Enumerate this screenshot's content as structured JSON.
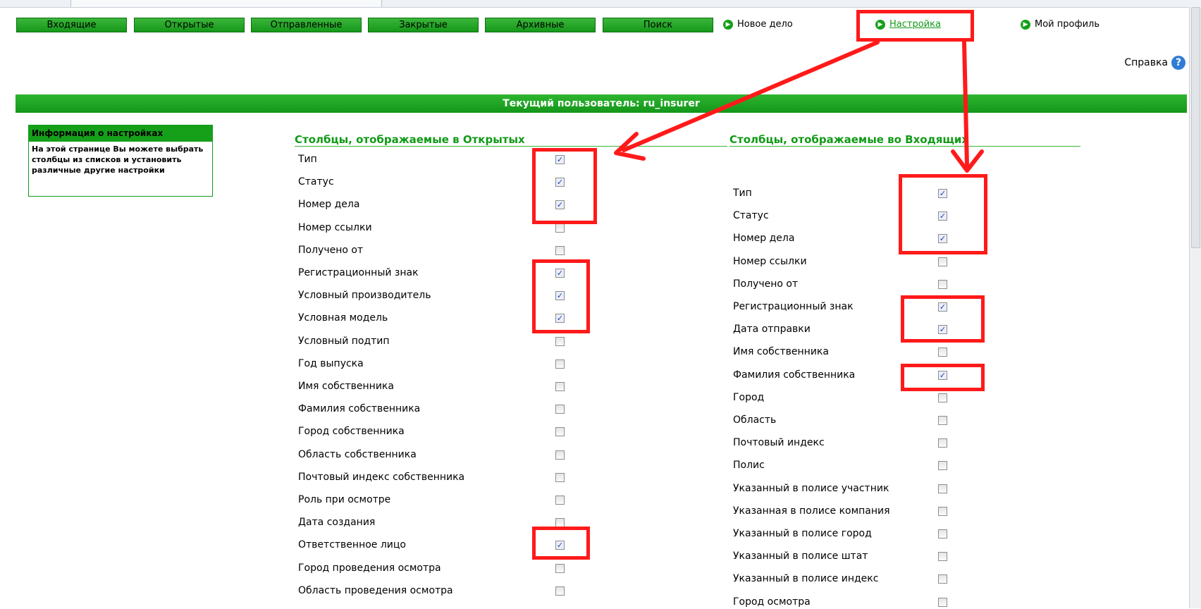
{
  "nav": {
    "tabs": [
      "Входящие",
      "Открытые",
      "Отправленные",
      "Закрытые",
      "Архивные",
      "Поиск"
    ],
    "links": [
      {
        "label": "Новое дело",
        "active": false
      },
      {
        "label": "Настройка",
        "active": true
      },
      {
        "label": "Мой профиль",
        "active": false
      }
    ]
  },
  "help": {
    "label": "Справка"
  },
  "user_bar": "Текущий пользователь: ru_insurer",
  "info": {
    "title": "Информация о настройках",
    "text": "На этой странице Вы можете выбрать столбцы из списков и установить различные другие настройки"
  },
  "open_section": {
    "heading": "Столбцы, отображаемые в Открытых",
    "rows": [
      {
        "label": "Тип",
        "checked": true
      },
      {
        "label": "Статус",
        "checked": true
      },
      {
        "label": "Номер дела",
        "checked": true
      },
      {
        "label": "Номер ссылки",
        "checked": false
      },
      {
        "label": "Получено от",
        "checked": false
      },
      {
        "label": "Регистрационный знак",
        "checked": true
      },
      {
        "label": "Условный производитель",
        "checked": true
      },
      {
        "label": "Условная модель",
        "checked": true
      },
      {
        "label": "Условный подтип",
        "checked": false
      },
      {
        "label": "Год выпуска",
        "checked": false
      },
      {
        "label": "Имя собственника",
        "checked": false
      },
      {
        "label": "Фамилия собственника",
        "checked": false
      },
      {
        "label": "Город собственника",
        "checked": false
      },
      {
        "label": "Область собственника",
        "checked": false
      },
      {
        "label": "Почтовый индекс собственника",
        "checked": false
      },
      {
        "label": "Роль при осмотре",
        "checked": false
      },
      {
        "label": "Дата создания",
        "checked": false
      },
      {
        "label": "Ответственное лицо",
        "checked": true
      },
      {
        "label": "Город проведения осмотра",
        "checked": false
      },
      {
        "label": "Область проведения осмотра",
        "checked": false
      }
    ]
  },
  "inbox_section": {
    "heading": "Столбцы, отображаемые во Входящих",
    "rows": [
      {
        "label": "Тип",
        "checked": true
      },
      {
        "label": "Статус",
        "checked": true
      },
      {
        "label": "Номер дела",
        "checked": true
      },
      {
        "label": "Номер ссылки",
        "checked": false
      },
      {
        "label": "Получено от",
        "checked": false
      },
      {
        "label": "Регистрационный знак",
        "checked": true
      },
      {
        "label": "Дата отправки",
        "checked": true
      },
      {
        "label": "Имя собственника",
        "checked": false
      },
      {
        "label": "Фамилия собственника",
        "checked": true
      },
      {
        "label": "Город",
        "checked": false
      },
      {
        "label": "Область",
        "checked": false
      },
      {
        "label": "Почтовый индекс",
        "checked": false
      },
      {
        "label": "Полис",
        "checked": false
      },
      {
        "label": "Указанный в полисе участник",
        "checked": false
      },
      {
        "label": "Указанная в полисе компания",
        "checked": false
      },
      {
        "label": "Указанный в полисе город",
        "checked": false
      },
      {
        "label": "Указанный в полисе штат",
        "checked": false
      },
      {
        "label": "Указанный в полисе индекс",
        "checked": false
      },
      {
        "label": "Город осмотра",
        "checked": false
      }
    ]
  },
  "colors": {
    "accent": "#16a01a",
    "annotation": "#ff1a1a"
  }
}
